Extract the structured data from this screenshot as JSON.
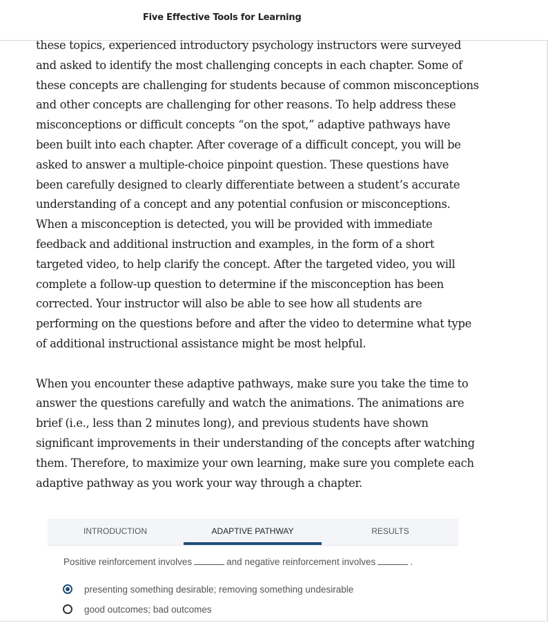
{
  "header": {
    "title": "Five Effective Tools for Learning"
  },
  "paragraphs": [
    {
      "lines": [
        "these topics, experienced introductory psychology instructors were surveyed",
        "and asked to identify the most challenging concepts in each chapter. Some of",
        "these concepts are challenging for students because of common misconceptions",
        "and other concepts are challenging for other reasons. To help address these",
        "misconceptions or difficult concepts “on the spot,” adaptive pathways have",
        "been built into each chapter. After coverage of a difficult concept, you will be",
        "asked to answer a multiple-choice pinpoint question. These questions have",
        "been carefully designed to clearly differentiate between a student’s accurate",
        "understanding of a concept and any potential confusion or misconceptions.",
        "When a misconception is detected, you will be provided with immediate",
        "feedback and additional instruction and examples, in the form of a short",
        "targeted video, to help clarify the concept. After the targeted video, you will",
        "complete a follow-up question to determine if the misconception has been",
        "corrected. Your instructor will also be able to see how all students are",
        "performing on the questions before and after the video to determine what type",
        "of additional instructional assistance might be most helpful."
      ]
    },
    {
      "lines": [
        "When you encounter these adaptive pathways, make sure you take the time to",
        "answer the questions carefully and watch the animations. The animations are",
        "brief (i.e., less than 2 minutes long), and previous students have shown",
        "significant improvements in their understanding of the concepts after watching",
        "them. Therefore, to maximize your own learning, make sure you complete each",
        "adaptive pathway as you work your way through a chapter."
      ]
    }
  ],
  "quiz": {
    "tabs": [
      {
        "label": "INTRODUCTION",
        "active": false
      },
      {
        "label": "ADAPTIVE PATHWAY",
        "active": true
      },
      {
        "label": "RESULTS",
        "active": false
      }
    ],
    "question": {
      "part1": "Positive reinforcement involves",
      "part2": "and negative reinforcement involves",
      "part3": "."
    },
    "options": [
      {
        "label": "presenting something desirable; removing something undesirable",
        "selected": true
      },
      {
        "label": "good outcomes; bad outcomes",
        "selected": false
      }
    ]
  },
  "colors": {
    "accent": "#1f4e79",
    "tab_bar": "#f3f5f8",
    "text": "#222222",
    "muted_text": "#555555"
  }
}
